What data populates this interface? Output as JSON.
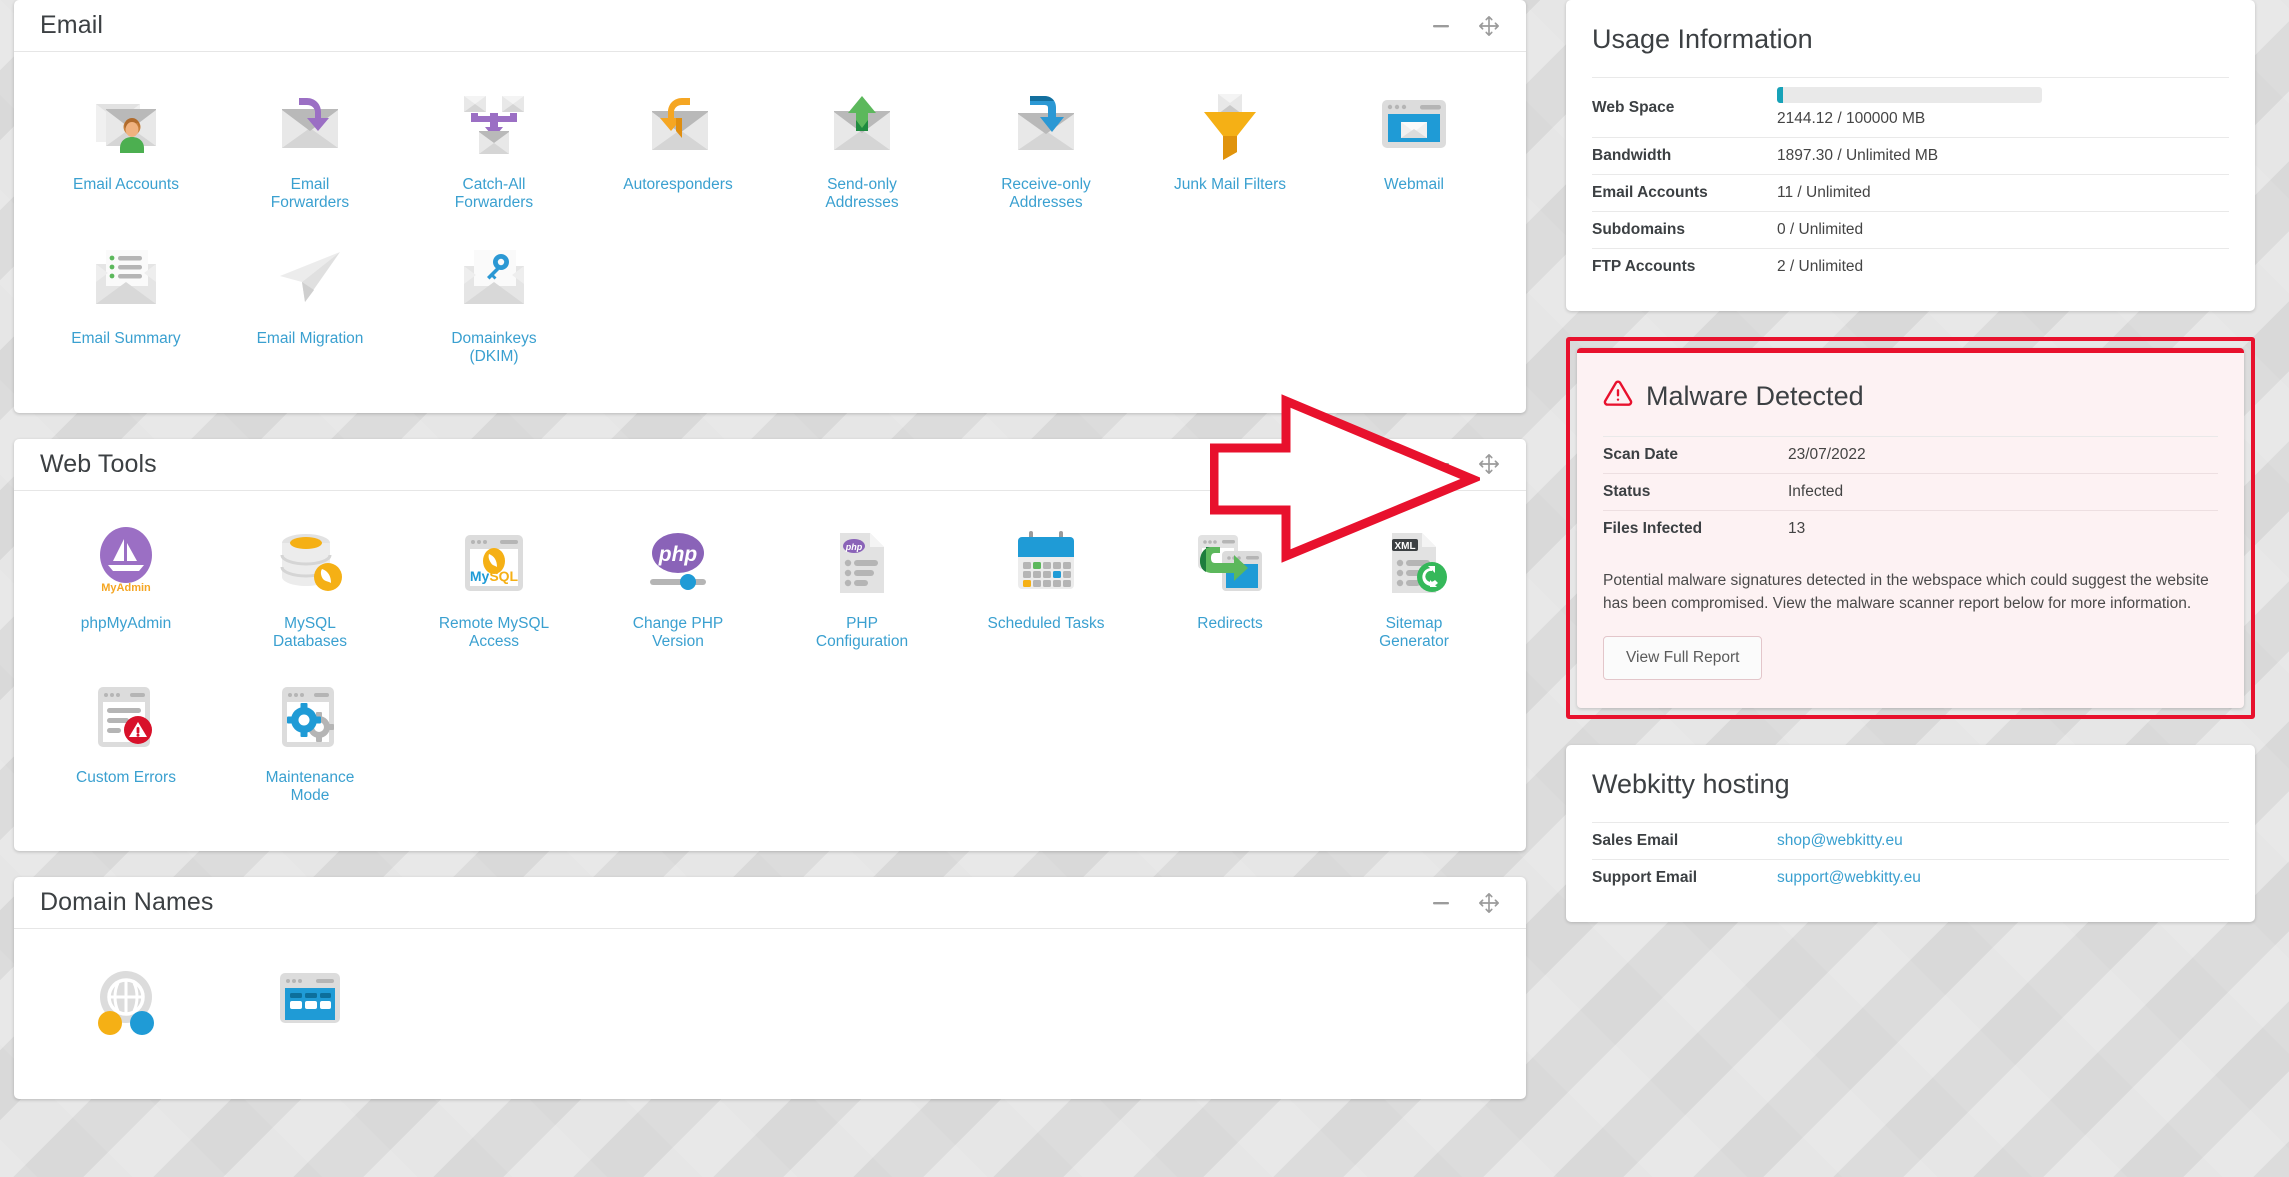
{
  "theme": {
    "link_color": "#3aa0d0",
    "danger_color": "#e8112d",
    "progress_color": "#17a2b8",
    "page_bg": "#dcdcdc"
  },
  "cards": [
    {
      "title": "Email",
      "actions": {
        "minimize": "minimize-icon",
        "move": "move-icon"
      },
      "tiles": [
        {
          "label": "Email Accounts",
          "icon": "envelope-user-icon"
        },
        {
          "label": "Email Forwarders",
          "icon": "envelope-forward-arrow-icon"
        },
        {
          "label": "Catch-All Forwarders",
          "icon": "envelopes-merge-arrow-icon"
        },
        {
          "label": "Autoresponders",
          "icon": "envelope-reply-arrow-icon"
        },
        {
          "label": "Send-only Addresses",
          "icon": "envelope-up-arrow-icon"
        },
        {
          "label": "Receive-only Addresses",
          "icon": "envelope-down-arrow-icon"
        },
        {
          "label": "Junk Mail Filters",
          "icon": "funnel-envelope-icon"
        },
        {
          "label": "Webmail",
          "icon": "browser-envelope-icon"
        },
        {
          "label": "Email Summary",
          "icon": "envelope-list-icon"
        },
        {
          "label": "Email Migration",
          "icon": "paper-plane-icon"
        },
        {
          "label": "Domainkeys (DKIM)",
          "icon": "envelope-key-icon"
        }
      ]
    },
    {
      "title": "Web Tools",
      "actions": {
        "minimize": "minimize-icon",
        "move": "move-icon"
      },
      "tiles": [
        {
          "label": "phpMyAdmin",
          "icon": "phpmyadmin-icon"
        },
        {
          "label": "MySQL Databases",
          "icon": "database-dolphin-icon"
        },
        {
          "label": "Remote MySQL Access",
          "icon": "browser-mysql-icon"
        },
        {
          "label": "Change PHP Version",
          "icon": "php-slider-icon"
        },
        {
          "label": "PHP Configuration",
          "icon": "php-document-icon"
        },
        {
          "label": "Scheduled Tasks",
          "icon": "calendar-icon"
        },
        {
          "label": "Redirects",
          "icon": "browser-redirect-arrow-icon"
        },
        {
          "label": "Sitemap Generator",
          "icon": "xml-refresh-document-icon"
        },
        {
          "label": "Custom Errors",
          "icon": "browser-error-icon"
        },
        {
          "label": "Maintenance Mode",
          "icon": "browser-gears-icon"
        }
      ]
    },
    {
      "title": "Domain Names",
      "actions": {
        "minimize": "minimize-icon",
        "move": "move-icon"
      },
      "tiles": [
        {
          "label": "",
          "icon": "globe-gear-icon"
        },
        {
          "label": "",
          "icon": "browser-blue-icon"
        }
      ]
    }
  ],
  "usage": {
    "title": "Usage Information",
    "web_space": {
      "label": "Web Space",
      "value": "2144.12 / 100000 MB",
      "percent": 2.14
    },
    "rows": [
      {
        "label": "Bandwidth",
        "value": "1897.30 / Unlimited MB"
      },
      {
        "label": "Email Accounts",
        "value": "11 / Unlimited"
      },
      {
        "label": "Subdomains",
        "value": "0 / Unlimited"
      },
      {
        "label": "FTP Accounts",
        "value": "2 / Unlimited"
      }
    ]
  },
  "malware": {
    "title": "Malware Detected",
    "warning_icon": "warning-triangle-icon",
    "rows": [
      {
        "label": "Scan Date",
        "value": "23/07/2022"
      },
      {
        "label": "Status",
        "value": "Infected"
      },
      {
        "label": "Files Infected",
        "value": "13"
      }
    ],
    "description": "Potential malware signatures detected in the webspace which could suggest the website has been compromised. View the malware scanner report below for more information.",
    "button_label": "View Full Report"
  },
  "hosting": {
    "title": "Webkitty hosting",
    "rows": [
      {
        "label": "Sales Email",
        "value": "shop@webkitty.eu"
      },
      {
        "label": "Support Email",
        "value": "support@webkitty.eu"
      }
    ]
  },
  "annotation": {
    "type": "red-arrow-right",
    "color": "#e8112d"
  }
}
